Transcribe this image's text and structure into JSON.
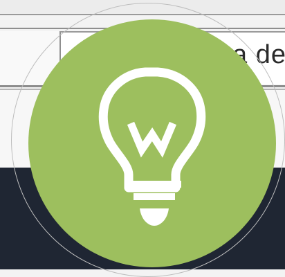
{
  "search": {
    "visible_text": "a de"
  },
  "logo": {
    "icon": "lightbulb-icon"
  },
  "colors": {
    "accent": "#9dbf5e",
    "footer": "#1f2633",
    "icon_fg": "#ffffff"
  }
}
